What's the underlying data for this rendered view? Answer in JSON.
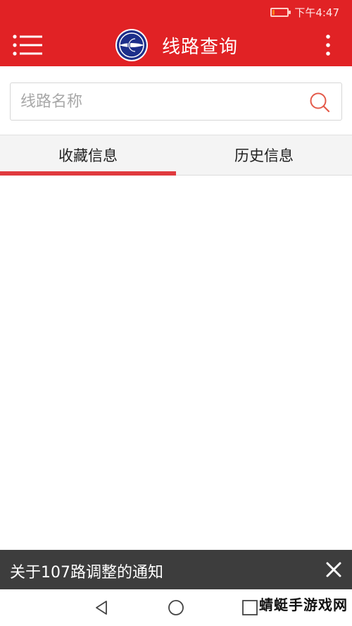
{
  "status_bar": {
    "time": "下午4:47",
    "battery_level": 0.15,
    "battery_color": "#ff7a1a"
  },
  "app_bar": {
    "title": "线路查询",
    "menu_icon": "hamburger-menu-icon",
    "more_icon": "more-vertical-icon",
    "logo_icon": "bus-logo-icon",
    "background": "#e12225"
  },
  "search": {
    "placeholder": "线路名称",
    "value": "",
    "icon": "search-icon"
  },
  "tabs": [
    {
      "label": "收藏信息",
      "active": true
    },
    {
      "label": "历史信息",
      "active": false
    }
  ],
  "notice": {
    "text": "关于107路调整的通知",
    "close_icon": "close-icon"
  },
  "nav_bar": {
    "back_icon": "back-triangle-icon",
    "home_icon": "home-circle-icon",
    "recent_icon": "recent-square-icon"
  },
  "watermark": "蜻蜓手游戏网",
  "colors": {
    "accent": "#e12225",
    "tab_indicator": "#e03a3e",
    "notice_bg": "#3d3d3d"
  }
}
